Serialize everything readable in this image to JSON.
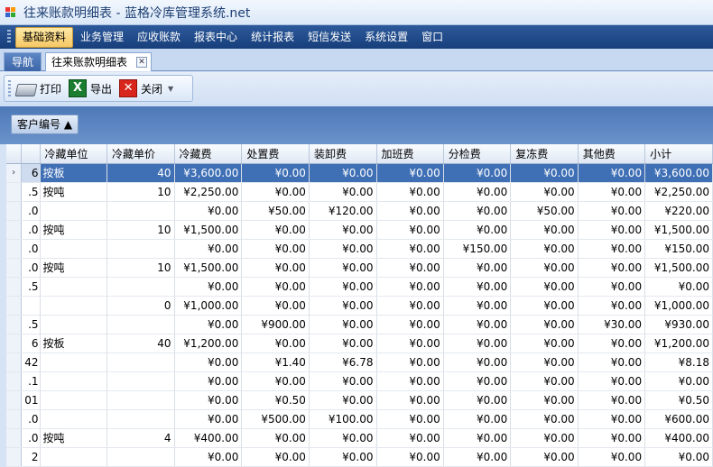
{
  "window": {
    "title": "往来账款明细表 - 蓝格冷库管理系统.net"
  },
  "menu": {
    "items": [
      "基础资料",
      "业务管理",
      "应收账款",
      "报表中心",
      "统计报表",
      "短信发送",
      "系统设置",
      "窗口"
    ],
    "active_index": 0
  },
  "tabs": {
    "nav_label": "导航",
    "main_label": "往来账款明细表"
  },
  "toolbar": {
    "print_label": "打印",
    "export_label": "导出",
    "close_label": "关闭"
  },
  "group_panel": {
    "chip_label": "客户编号 ▲"
  },
  "grid": {
    "columns": [
      "",
      "冷藏单位",
      "冷藏单价",
      "冷藏费",
      "处置费",
      "装卸费",
      "加班费",
      "分检费",
      "复冻费",
      "其他费",
      "小计"
    ],
    "selected_row": 0,
    "rows": [
      [
        "6",
        "按板",
        "40",
        "¥3,600.00",
        "¥0.00",
        "¥0.00",
        "¥0.00",
        "¥0.00",
        "¥0.00",
        "¥0.00",
        "¥3,600.00"
      ],
      [
        ".5",
        "按吨",
        "10",
        "¥2,250.00",
        "¥0.00",
        "¥0.00",
        "¥0.00",
        "¥0.00",
        "¥0.00",
        "¥0.00",
        "¥2,250.00"
      ],
      [
        ".0",
        "",
        "",
        "¥0.00",
        "¥50.00",
        "¥120.00",
        "¥0.00",
        "¥0.00",
        "¥50.00",
        "¥0.00",
        "¥220.00"
      ],
      [
        ".0",
        "按吨",
        "10",
        "¥1,500.00",
        "¥0.00",
        "¥0.00",
        "¥0.00",
        "¥0.00",
        "¥0.00",
        "¥0.00",
        "¥1,500.00"
      ],
      [
        ".0",
        "",
        "",
        "¥0.00",
        "¥0.00",
        "¥0.00",
        "¥0.00",
        "¥150.00",
        "¥0.00",
        "¥0.00",
        "¥150.00"
      ],
      [
        ".0",
        "按吨",
        "10",
        "¥1,500.00",
        "¥0.00",
        "¥0.00",
        "¥0.00",
        "¥0.00",
        "¥0.00",
        "¥0.00",
        "¥1,500.00"
      ],
      [
        ".5",
        "",
        "",
        "¥0.00",
        "¥0.00",
        "¥0.00",
        "¥0.00",
        "¥0.00",
        "¥0.00",
        "¥0.00",
        "¥0.00"
      ],
      [
        "",
        "",
        "0",
        "¥1,000.00",
        "¥0.00",
        "¥0.00",
        "¥0.00",
        "¥0.00",
        "¥0.00",
        "¥0.00",
        "¥1,000.00"
      ],
      [
        ".5",
        "",
        "",
        "¥0.00",
        "¥900.00",
        "¥0.00",
        "¥0.00",
        "¥0.00",
        "¥0.00",
        "¥30.00",
        "¥930.00"
      ],
      [
        "6",
        "按板",
        "40",
        "¥1,200.00",
        "¥0.00",
        "¥0.00",
        "¥0.00",
        "¥0.00",
        "¥0.00",
        "¥0.00",
        "¥1,200.00"
      ],
      [
        "42",
        "",
        "",
        "¥0.00",
        "¥1.40",
        "¥6.78",
        "¥0.00",
        "¥0.00",
        "¥0.00",
        "¥0.00",
        "¥8.18"
      ],
      [
        ".1",
        "",
        "",
        "¥0.00",
        "¥0.00",
        "¥0.00",
        "¥0.00",
        "¥0.00",
        "¥0.00",
        "¥0.00",
        "¥0.00"
      ],
      [
        "01",
        "",
        "",
        "¥0.00",
        "¥0.50",
        "¥0.00",
        "¥0.00",
        "¥0.00",
        "¥0.00",
        "¥0.00",
        "¥0.50"
      ],
      [
        ".0",
        "",
        "",
        "¥0.00",
        "¥500.00",
        "¥100.00",
        "¥0.00",
        "¥0.00",
        "¥0.00",
        "¥0.00",
        "¥600.00"
      ],
      [
        ".0",
        "按吨",
        "4",
        "¥400.00",
        "¥0.00",
        "¥0.00",
        "¥0.00",
        "¥0.00",
        "¥0.00",
        "¥0.00",
        "¥400.00"
      ],
      [
        "2",
        "",
        "",
        "¥0.00",
        "¥0.00",
        "¥0.00",
        "¥0.00",
        "¥0.00",
        "¥0.00",
        "¥0.00",
        "¥0.00"
      ]
    ]
  },
  "colors": {
    "menubar": "#1f4a8a",
    "selection": "#3f6fb5",
    "active_menu": "#f6c865"
  },
  "icons": [
    "app-icon",
    "printer-icon",
    "excel-icon",
    "close-icon",
    "chevron-down-icon",
    "sort-asc-icon",
    "row-indicator-icon"
  ]
}
